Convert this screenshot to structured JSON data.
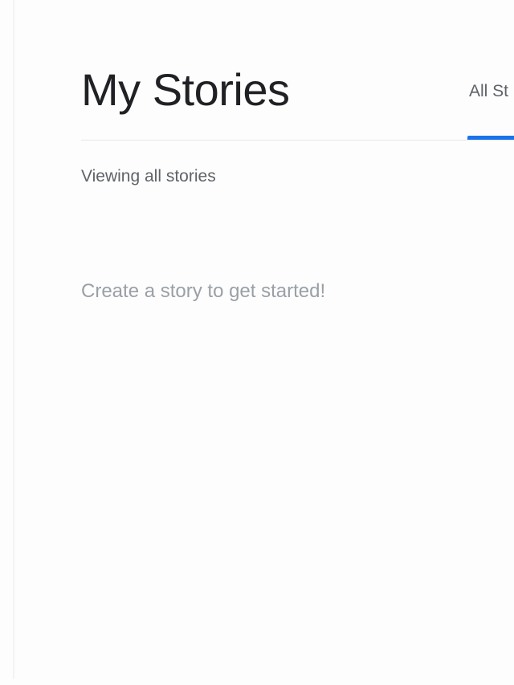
{
  "header": {
    "title": "My Stories",
    "tabs": [
      {
        "label": "All St",
        "active": true
      }
    ]
  },
  "filter": {
    "viewing_label": "Viewing all stories"
  },
  "empty_state": {
    "message": "Create a story to get started!"
  },
  "colors": {
    "accent": "#1a73e8",
    "title_text": "#202124",
    "secondary_text": "#5f6368",
    "muted_text": "#9aa0a6",
    "divider": "#e6e7e8"
  }
}
